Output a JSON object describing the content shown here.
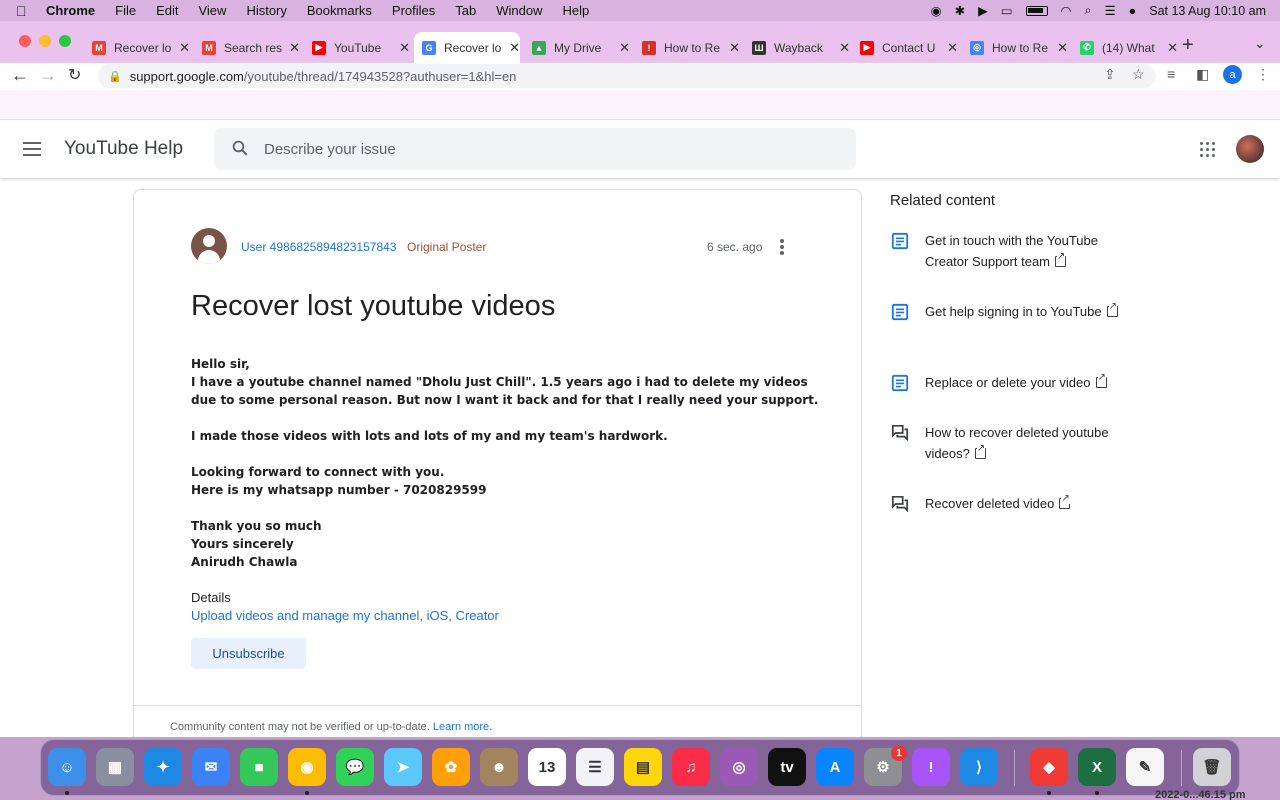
{
  "menubar": {
    "app": "Chrome",
    "items": [
      "File",
      "Edit",
      "View",
      "History",
      "Bookmarks",
      "Profiles",
      "Tab",
      "Window",
      "Help"
    ],
    "datetime": "Sat 13 Aug  10:10 am"
  },
  "tabs": [
    {
      "title": "Recover lo",
      "icon": "gmail-icon",
      "color": "#ea4335",
      "glyph": "M"
    },
    {
      "title": "Search res",
      "icon": "gmail-icon",
      "color": "#ea4335",
      "glyph": "M"
    },
    {
      "title": "YouTube",
      "icon": "youtube-icon",
      "color": "#ff0000",
      "glyph": "▶"
    },
    {
      "title": "Recover lo",
      "icon": "google-icon",
      "color": "#4285f4",
      "glyph": "G",
      "active": true
    },
    {
      "title": "My Drive",
      "icon": "drive-icon",
      "color": "#34a853",
      "glyph": "▲"
    },
    {
      "title": "How to Re",
      "icon": "article-icon",
      "color": "#d93025",
      "glyph": "!"
    },
    {
      "title": "Wayback",
      "icon": "archive-icon",
      "color": "#333333",
      "glyph": "Ш"
    },
    {
      "title": "Contact U",
      "icon": "youtube-icon",
      "color": "#ff0000",
      "glyph": "▶"
    },
    {
      "title": "How to Re",
      "icon": "globe-icon",
      "color": "#4285f4",
      "glyph": "◎"
    },
    {
      "title": "(14) What",
      "icon": "whatsapp-icon",
      "color": "#25d366",
      "glyph": "✆"
    }
  ],
  "address": {
    "host": "support.google.com",
    "path": "/youtube/thread/174943528?authuser=1&hl=en",
    "profile_initial": "a"
  },
  "header": {
    "title": "YouTube Help",
    "search_placeholder": "Describe your issue"
  },
  "post": {
    "username": "User 4986825894823157843",
    "badge": "Original Poster",
    "time": "6 sec. ago",
    "title": "Recover lost youtube videos",
    "paragraphs": [
      [
        "Hello sir,",
        "I have a youtube channel named \"Dholu Just Chill\". 1.5 years ago i had to delete my videos due to some personal reason. But now I want it back and for that I really need your support."
      ],
      [
        "I made those videos with lots and lots of my and my team's hardwork."
      ],
      [
        "Looking forward to connect with you.",
        "Here is my whatsapp number - 7020829599"
      ],
      [
        "Thank you so much",
        "Yours sincerely",
        "Anirudh Chawla"
      ]
    ],
    "details_label": "Details",
    "details_links": [
      "Upload videos and manage my channel",
      "iOS",
      "Creator"
    ],
    "unsubscribe": "Unsubscribe",
    "community_note": "Community content may not be verified or up-to-date.",
    "learn_more": "Learn more."
  },
  "related": {
    "heading": "Related content",
    "items": [
      {
        "text": "Get in touch with the YouTube Creator Support team",
        "icon": "article-icon"
      },
      {
        "text": "Get help signing in to YouTube",
        "icon": "article-icon"
      },
      {
        "text": "Replace or delete your video",
        "icon": "article-icon"
      },
      {
        "text": "How to recover deleted youtube videos?",
        "icon": "forum-icon"
      },
      {
        "text": "Recover deleted video",
        "icon": "forum-icon"
      }
    ]
  },
  "dock": {
    "apps": [
      {
        "name": "finder-icon",
        "color": "#3d8fe8",
        "glyph": "☺"
      },
      {
        "name": "launchpad-icon",
        "color": "#8a8fa0",
        "glyph": "▦"
      },
      {
        "name": "safari-icon",
        "color": "#1e88e5",
        "glyph": "✦"
      },
      {
        "name": "mail-icon",
        "color": "#3b82f6",
        "glyph": "✉"
      },
      {
        "name": "facetime-icon",
        "color": "#34c759",
        "glyph": "■"
      },
      {
        "name": "chrome-icon",
        "color": "#fbbc04",
        "glyph": "◉"
      },
      {
        "name": "messages-icon",
        "color": "#30d158",
        "glyph": "💬"
      },
      {
        "name": "maps-icon",
        "color": "#5ac8fa",
        "glyph": "➤"
      },
      {
        "name": "photos-icon",
        "color": "#ff9f0a",
        "glyph": "✿"
      },
      {
        "name": "contacts-icon",
        "color": "#a2845e",
        "glyph": "☻"
      },
      {
        "name": "calendar-icon",
        "color": "#ffffff",
        "glyph": "13"
      },
      {
        "name": "reminders-icon",
        "color": "#f2f2f7",
        "glyph": "☰"
      },
      {
        "name": "notes-icon",
        "color": "#ffd60a",
        "glyph": "▤"
      },
      {
        "name": "music-icon",
        "color": "#fa2d48",
        "glyph": "♫"
      },
      {
        "name": "podcasts-icon",
        "color": "#9b59b6",
        "glyph": "◎"
      },
      {
        "name": "appletv-icon",
        "color": "#111111",
        "glyph": "tv"
      },
      {
        "name": "appstore-icon",
        "color": "#0a84ff",
        "glyph": "A"
      },
      {
        "name": "settings-icon",
        "color": "#8e8e93",
        "glyph": "⚙",
        "badge": "1"
      },
      {
        "name": "feedback-icon",
        "color": "#a855f7",
        "glyph": "!"
      },
      {
        "name": "vscode-icon",
        "color": "#1e88e5",
        "glyph": "⟩"
      },
      {
        "name": "anydesk-icon",
        "color": "#ef3b36",
        "glyph": "◆"
      },
      {
        "name": "excel-icon",
        "color": "#1d6f42",
        "glyph": "X"
      },
      {
        "name": "textedit-icon",
        "color": "#f5f5f5",
        "glyph": "✎"
      },
      {
        "name": "trash-icon",
        "color": "#d1d1d6",
        "glyph": "🗑"
      }
    ],
    "clock_peek": "2022-0...46.15 pm"
  }
}
